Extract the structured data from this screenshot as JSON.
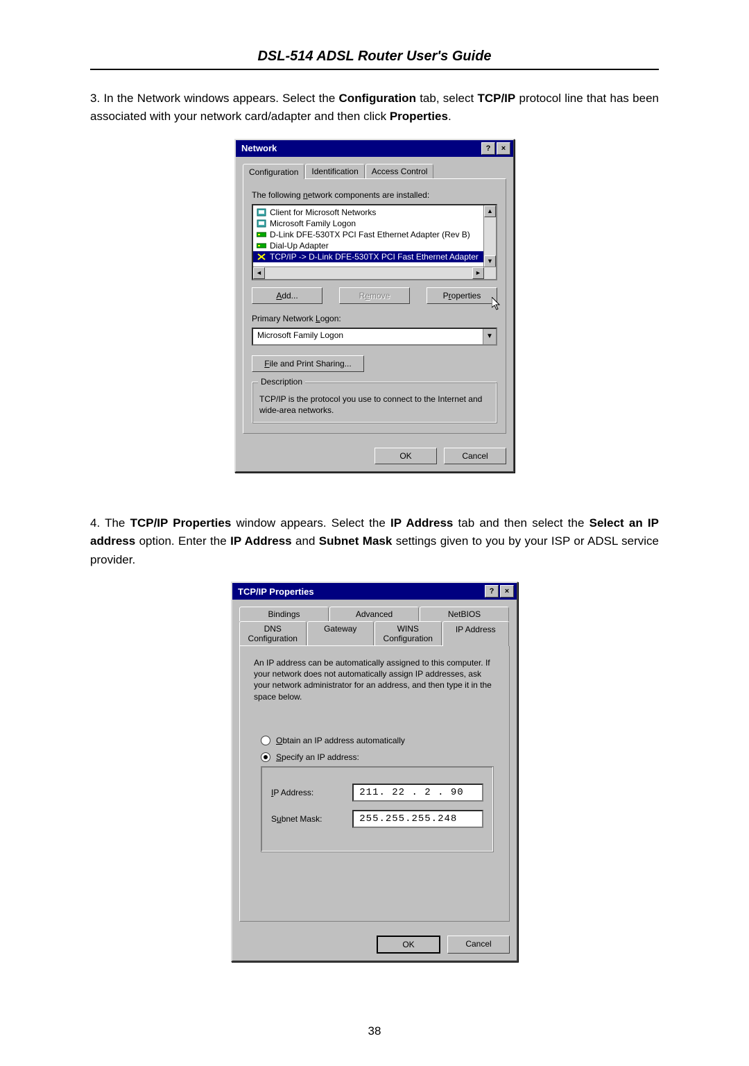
{
  "page_title": "DSL-514 ADSL Router User's Guide",
  "page_number": "38",
  "step3": {
    "num": "3.",
    "pre": "In the Network windows appears. Select the ",
    "b1": "Configuration",
    "mid1": " tab, select ",
    "b2": "TCP/IP",
    "mid2": " protocol line that has been associated with your network card/adapter and then click ",
    "b3": "Properties",
    "end": "."
  },
  "step4": {
    "num": "4.",
    "pre": "The ",
    "b1": "TCP/IP Properties",
    "mid1": " window appears. Select the ",
    "b2": "IP Address",
    "mid2": " tab and then select the ",
    "b3": "Select an IP address",
    "mid3": " option. Enter the ",
    "b4": "IP Address",
    "mid4": " and ",
    "b5": "Subnet Mask",
    "end": " settings given to you by your ISP or ADSL service provider."
  },
  "dlg1": {
    "title": "Network",
    "help": "?",
    "close": "×",
    "tabs": {
      "configuration": "Configuration",
      "identification": "Identification",
      "access": "Access Control"
    },
    "installed_label": "The following network components are installed:",
    "items": [
      "Client for Microsoft Networks",
      "Microsoft Family Logon",
      "D-Link DFE-530TX PCI Fast Ethernet Adapter (Rev B)",
      "Dial-Up Adapter",
      "TCP/IP -> D-Link DFE-530TX PCI Fast Ethernet Adapter"
    ],
    "buttons": {
      "add": "Add...",
      "remove": "Remove",
      "properties": "Properties"
    },
    "primary_logon_label": "Primary Network Logon:",
    "primary_logon_value": "Microsoft Family Logon",
    "file_print": "File and Print Sharing...",
    "desc_label": "Description",
    "desc_text": "TCP/IP is the protocol you use to connect to the Internet and wide-area networks.",
    "ok": "OK",
    "cancel": "Cancel"
  },
  "dlg2": {
    "title": "TCP/IP Properties",
    "help": "?",
    "close": "×",
    "tabs_row1": {
      "bindings": "Bindings",
      "advanced": "Advanced",
      "netbios": "NetBIOS"
    },
    "tabs_row2": {
      "dns": "DNS Configuration",
      "gateway": "Gateway",
      "wins": "WINS Configuration",
      "ip": "IP Address"
    },
    "blurb": "An IP address can be automatically assigned to this computer. If your network does not automatically assign IP addresses, ask your network administrator for an address, and then type it in the space below.",
    "radio_auto": "Obtain an IP address automatically",
    "radio_specify": "Specify an IP address:",
    "ip_label": "IP Address:",
    "ip_value": "211. 22 . 2 . 90",
    "mask_label": "Subnet Mask:",
    "mask_value": "255.255.255.248",
    "ok": "OK",
    "cancel": "Cancel"
  }
}
